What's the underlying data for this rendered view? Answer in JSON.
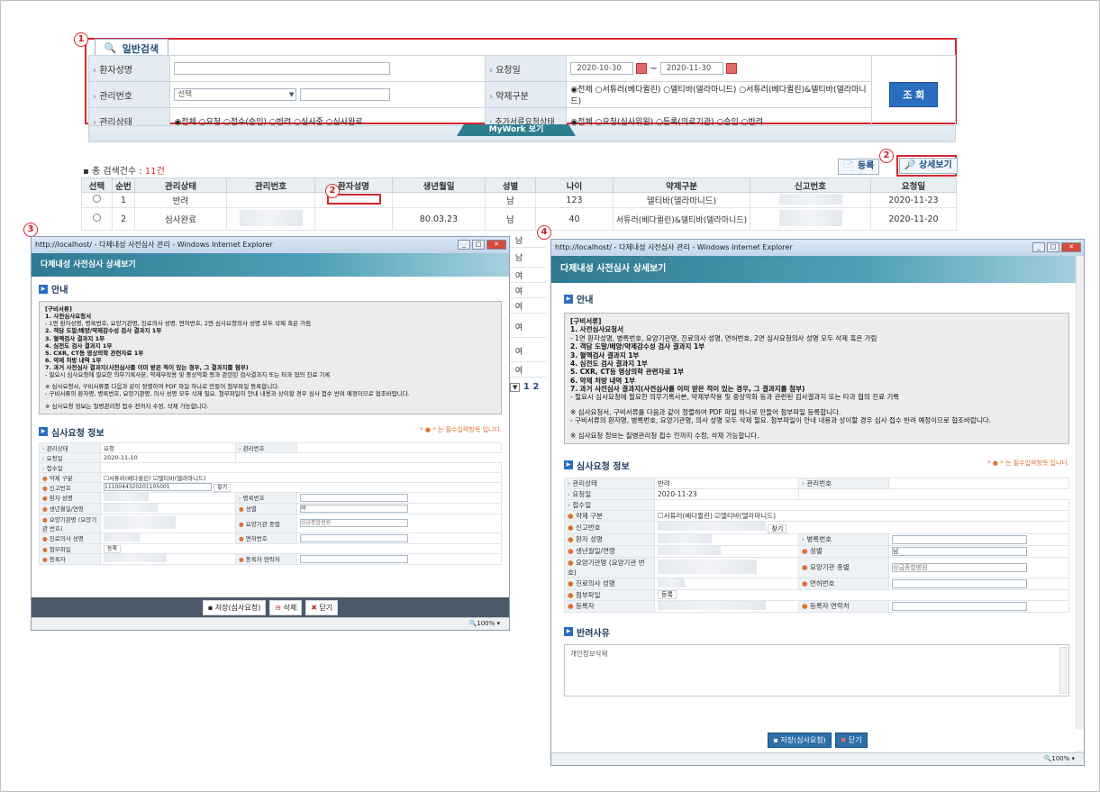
{
  "search": {
    "tab_label": "일반검색",
    "labels": {
      "patient_name": "환자성명",
      "mgmt_no": "관리번호",
      "mgmt_status": "관리상태",
      "request_date": "요청일",
      "drug_type": "약제구분",
      "extra_doc": "추가서류요청상태"
    },
    "mgmt_no_select": "선택",
    "date_from": "2020-10-30",
    "date_sep": "~",
    "date_to": "2020-11-30",
    "drug_options": "◉전체 ○서튜러(베다퀼린) ○델티바(델라마니드) ○서튜러(베다퀼린)&델티바(델라마니드)",
    "status_options": "◉전체 ○요청 ○접수(승인) ○반려 ○심사중 ○심사완료",
    "extra_options": "◉전체 ○요청(심사위원) ○등록(의료기관) ○승인 ○반려",
    "search_button": "조 회",
    "mywork": "MyWork 보기"
  },
  "list": {
    "total_label": "총 검색건수 :",
    "total_count": "11건",
    "register_button": "등록",
    "detail_button": "상세보기",
    "headers": [
      "선택",
      "순번",
      "관리상태",
      "관리번호",
      "환자성명",
      "생년월일",
      "성별",
      "나이",
      "약제구분",
      "신고번호",
      "요청일"
    ],
    "rows": [
      {
        "no": "1",
        "status": "반려",
        "birth": "",
        "sex": "남",
        "age": "123",
        "drug": "델티바(델라마니드)",
        "date": "2020-11-23"
      },
      {
        "no": "2",
        "status": "심사완료",
        "birth": "80.03.23",
        "sex": "남",
        "age": "40",
        "drug": "서튜러(베다퀼린)&델티바(델라마니드)",
        "date": "2020-11-20"
      }
    ],
    "partial_sex": [
      "남",
      "남",
      "여",
      "여",
      "여",
      "여",
      "여",
      "여"
    ],
    "page": "1 2"
  },
  "markers": [
    "1",
    "2",
    "2",
    "3",
    "4"
  ],
  "popup3": {
    "title": "http://localhost/ - 다제내성 사전심사 관리 - Windows Internet Explorer",
    "header": "다제내성 사전심사 상세보기",
    "notice": "안내",
    "guide": [
      "[구비서류]",
      "1. 사전심사요청서",
      "  - 1면 환자성명, 병록번호, 요양기관명, 진료의사 성명, 면허번호, 2면 심사요청의사 성명 모두 삭제 혹은 가림",
      "2. 객담 도말/배양/약제감수성 검사 결과지 1부",
      "3. 혈액검사 결과지 1부",
      "4. 심전도 검사 결과지 1부",
      "5. CXR, CT등 영상의학 관련자료 1부",
      "6. 약제 처방 내역 1부",
      "7. 과거 사전심사 결과지(사전심사를 이미 받은 적이 있는 경우, 그 결과지를 첨부)",
      "  - 필요시 심사요청에 필요한 의무기록사본, 약제부작용 및 중상악화 등과 관련된 검사결과지 또는 타과 협의 진료 기록",
      "※ 심사요청서, 구비서류를 다음과 같이 정렬하여 PDF 파일 하나로 만들어 첨부파일 등록합니다.",
      "  - 구비서류의 환자명, 병록번호, 요양기관명, 의사 성명 모두 삭제 필요. 첨부파일이 안내 내용과 상이할 경우 심사 접수 반려 예정이므로 협조바랍니다.",
      "※ 심사요청 정보는 질병관리청 접수 전까지 수정, 삭제 가능합니다."
    ],
    "section": "심사요청 정보",
    "required": "* ● * 는 필수입력항목 입니다.",
    "fields": {
      "status_l": "관리상태",
      "status_v": "요청",
      "mgmt_l": "관리번호",
      "date_l": "요청일",
      "date_v": "2020-11-10",
      "recv_l": "접수일",
      "drug_l": "약제 구분",
      "drug_v": "☐서튜러(베다퀼린) ☑델티바(델라마니드)",
      "report_l": "신고번호",
      "report_v": "1110044320201105001",
      "find": "찾기",
      "pname_l": "환자 성명",
      "chart_l": "병록번호",
      "birth_l": "생년월일/연령",
      "sex_l": "성별",
      "sex_v": "여",
      "inst_l": "요양기관명 (요양기관 번호)",
      "itype_l": "요양기관 종별",
      "itype_v": "상급종합병원",
      "doctor_l": "진료의사 성명",
      "license_l": "면허번호",
      "file_l": "첨부파일",
      "file_btn": "등록",
      "reg_l": "등록자",
      "regtel_l": "등록자 연락처"
    },
    "buttons": [
      "저장(심사요청)",
      "삭제",
      "닫기"
    ],
    "zoom": "100%"
  },
  "popup4": {
    "title": "http://localhost/ - 다제내성 사전심사 관리 - Windows Internet Explorer",
    "header": "다제내성 사전심사 상세보기",
    "notice": "안내",
    "guide": [
      "[구비서류]",
      "1. 사전심사요청서",
      "  - 1면 환자성명, 병록번호, 요양기관명, 진료의사 성명, 면허번호, 2면 심사요청의사 성명 모두 삭제 혹은 가림",
      "2. 객담 도말/배양/약제감수성 검사 결과지 1부",
      "3. 혈액검사 결과지 1부",
      "4. 심전도 검사 결과지 1부",
      "5. CXR, CT등 영상의학 관련자료 1부",
      "6. 약제 처방 내역 1부",
      "7. 과거 사전심사 결과지(사전심사를 이미 받은 적이 있는 경우, 그 결과지를 첨부)",
      "  - 필요시 심사요청에 필요한 의무기록사본, 약제부작용 및 중상악화 등과 관련된 검사결과지 또는 타과 협의 진료 기록",
      "※ 심사요청서, 구비서류를 다음과 같이 정렬하여 PDF 파일 하나로 만들어 첨부파일 등록합니다.",
      "  - 구비서류의 환자명, 병록번호, 요양기관명, 의사 성명 모두 삭제 필요. 첨부파일이 안내 내용과 상이할 경우 심사 접수 반려 예정이므로 협조바랍니다.",
      "※ 심사요청 정보는 질병관리청 접수 전까지 수정, 삭제 가능합니다."
    ],
    "section": "심사요청 정보",
    "required": "* ● * 는 필수입력항목 입니다.",
    "fields": {
      "status_l": "관리상태",
      "status_v": "반려",
      "mgmt_l": "관리번호",
      "date_l": "요청일",
      "date_v": "2020-11-23",
      "recv_l": "접수일",
      "drug_l": "약제 구분",
      "drug_v": "☐서튜러(베다퀼린) ☑델티바(델라마니드)",
      "report_l": "신고번호",
      "find": "찾기",
      "pname_l": "환자 성명",
      "chart_l": "병록번호",
      "birth_l": "생년월일/연령",
      "sex_l": "성별",
      "sex_v": "남",
      "inst_l": "요양기관명 (요양기관 번호)",
      "itype_l": "요양기관 종별",
      "itype_v": "상급종합병원",
      "doctor_l": "진료의사 성명",
      "license_l": "면허번호",
      "file_l": "첨부파일",
      "file_btn": "등록",
      "reg_l": "등록자",
      "regtel_l": "등록자 연락처"
    },
    "reject_section": "반려사유",
    "reject_text": "개인정보삭제",
    "buttons": [
      "저장(심사요청)",
      "닫기"
    ],
    "zoom": "100%"
  }
}
